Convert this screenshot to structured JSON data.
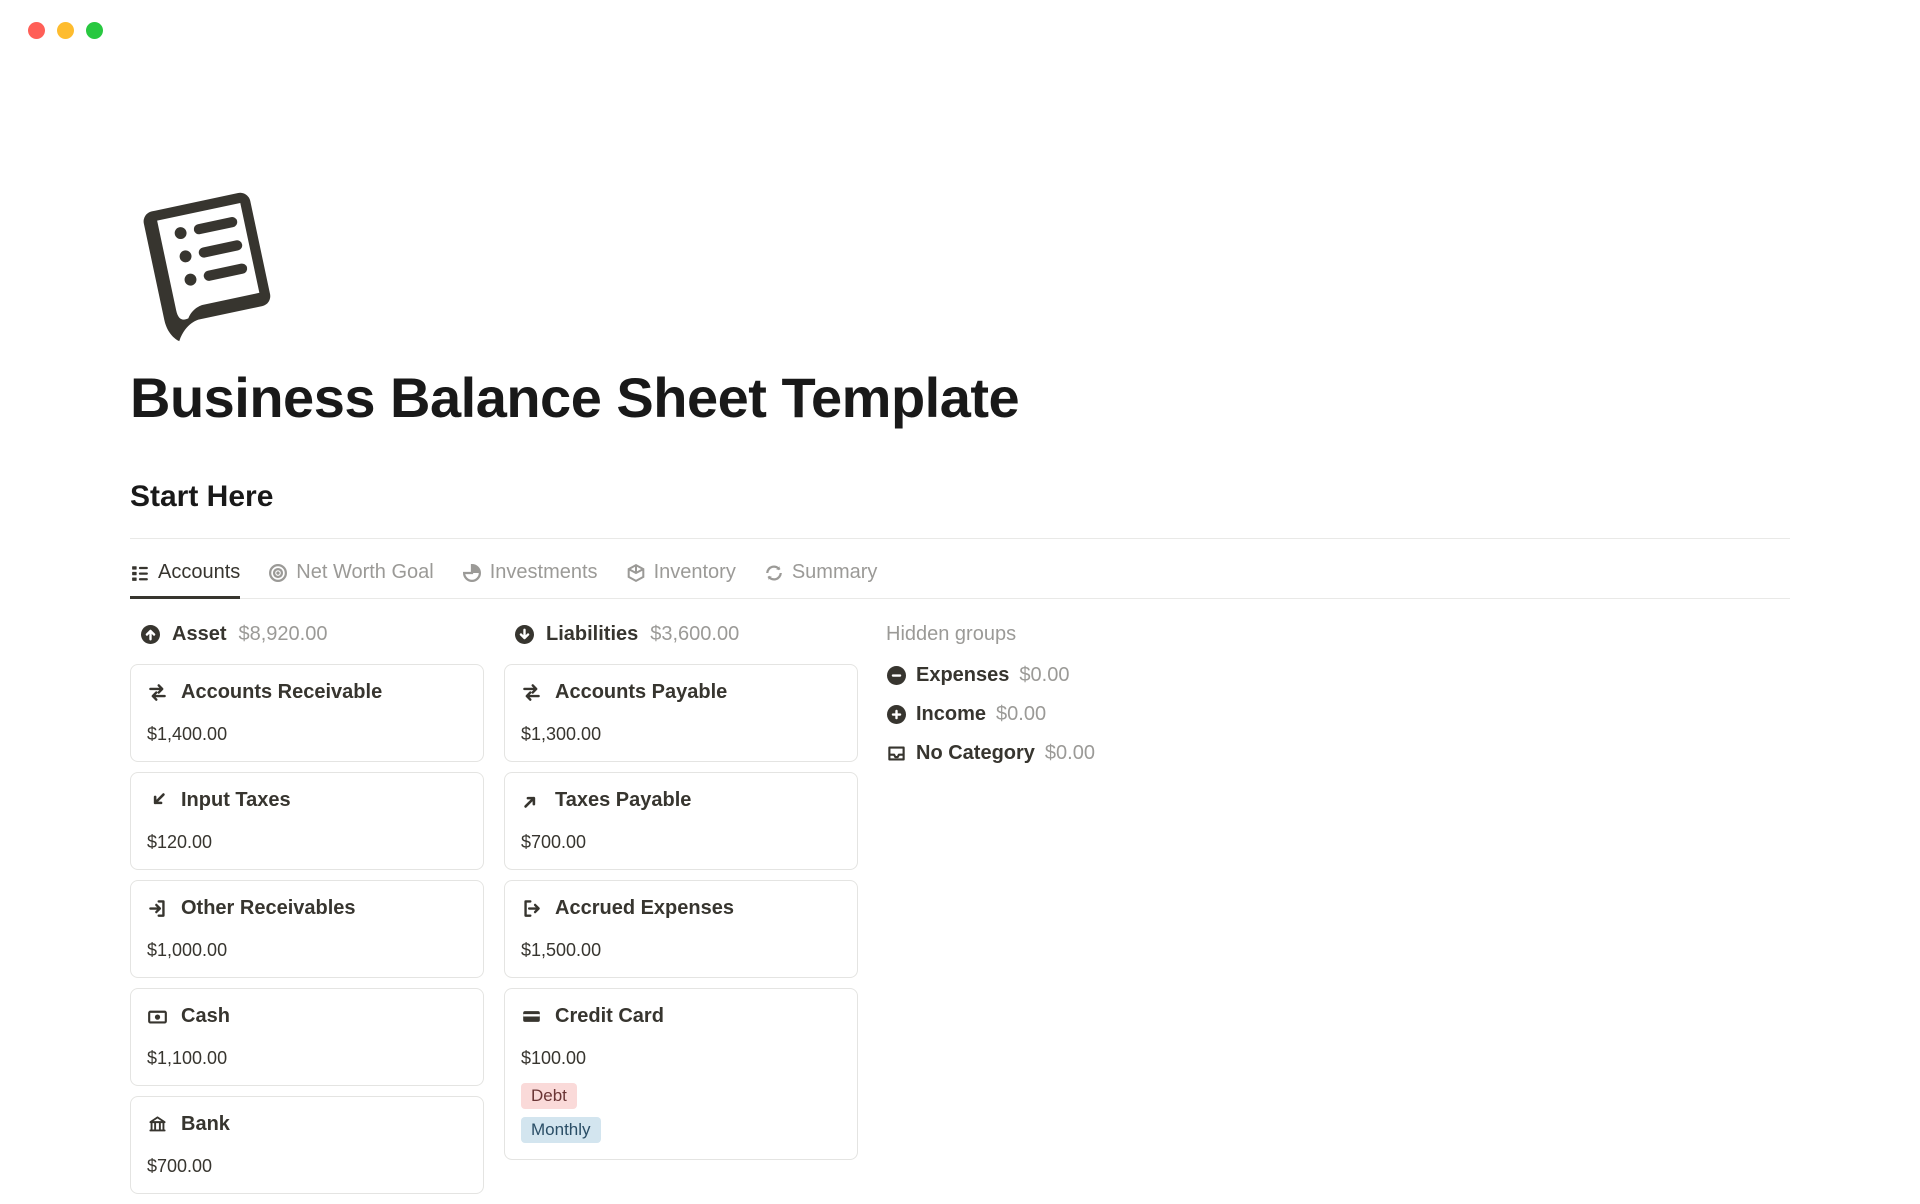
{
  "page": {
    "title": "Business Balance Sheet Template",
    "section": "Start Here"
  },
  "tabs": [
    {
      "label": "Accounts",
      "active": true
    },
    {
      "label": "Net Worth Goal",
      "active": false
    },
    {
      "label": "Investments",
      "active": false
    },
    {
      "label": "Inventory",
      "active": false
    },
    {
      "label": "Summary",
      "active": false
    }
  ],
  "columns": {
    "asset": {
      "title": "Asset",
      "total": "$8,920.00",
      "cards": [
        {
          "icon": "transfer-icon",
          "title": "Accounts Receivable",
          "amount": "$1,400.00"
        },
        {
          "icon": "arrow-in-icon",
          "title": "Input Taxes",
          "amount": "$120.00"
        },
        {
          "icon": "login-icon",
          "title": "Other Receivables",
          "amount": "$1,000.00"
        },
        {
          "icon": "cash-icon",
          "title": "Cash",
          "amount": "$1,100.00"
        },
        {
          "icon": "bank-icon",
          "title": "Bank",
          "amount": "$700.00"
        }
      ]
    },
    "liabilities": {
      "title": "Liabilities",
      "total": "$3,600.00",
      "cards": [
        {
          "icon": "transfer-icon",
          "title": "Accounts Payable",
          "amount": "$1,300.00"
        },
        {
          "icon": "arrow-out-icon",
          "title": "Taxes Payable",
          "amount": "$700.00"
        },
        {
          "icon": "logout-icon",
          "title": "Accrued Expenses",
          "amount": "$1,500.00"
        },
        {
          "icon": "credit-card-icon",
          "title": "Credit Card",
          "amount": "$100.00",
          "tags": [
            "Debt",
            "Monthly"
          ]
        }
      ]
    }
  },
  "hidden": {
    "title": "Hidden groups",
    "rows": [
      {
        "icon": "minus-circle-icon",
        "label": "Expenses",
        "total": "$0.00"
      },
      {
        "icon": "plus-circle-icon",
        "label": "Income",
        "total": "$0.00"
      },
      {
        "icon": "inbox-icon",
        "label": "No Category",
        "total": "$0.00"
      }
    ]
  },
  "tag_styles": {
    "Debt": "tag-red",
    "Monthly": "tag-blue"
  }
}
